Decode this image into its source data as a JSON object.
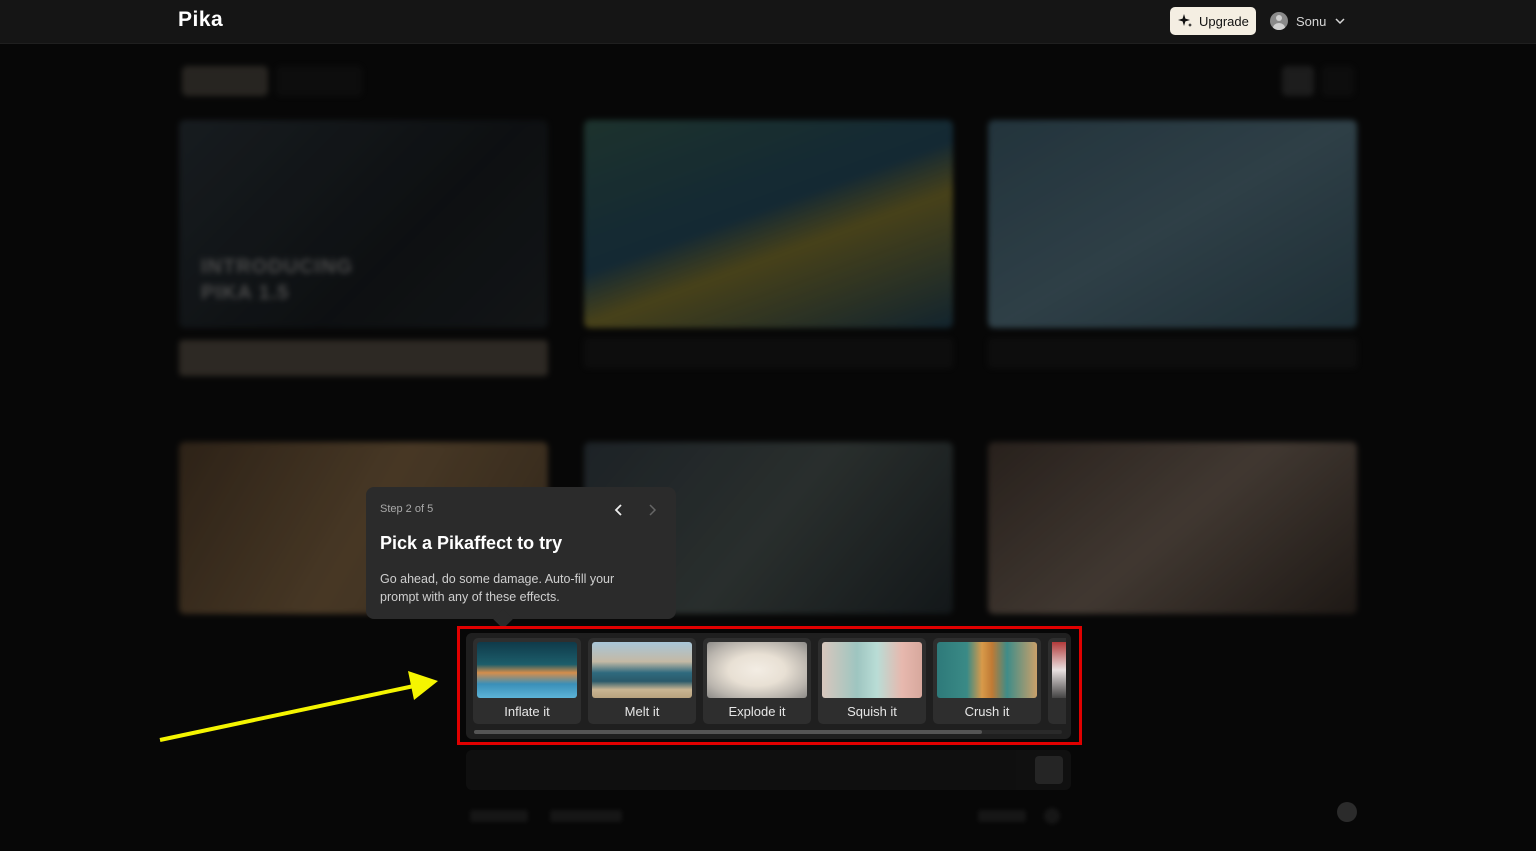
{
  "header": {
    "logo": "Pika",
    "upgrade_label": "Upgrade",
    "user_name": "Sonu"
  },
  "background": {
    "tile_text_line1": "INTRODUCING",
    "tile_text_line2": "PIKA 1.5"
  },
  "tooltip": {
    "step": "Step 2 of 5",
    "title": "Pick a Pikaffect to try",
    "body": "Go ahead, do some damage. Auto-fill your prompt with any of these effects."
  },
  "effects": [
    {
      "label": "Inflate it",
      "icon": "dog-on-pillow-thumbnail"
    },
    {
      "label": "Melt it",
      "icon": "van-in-desert-thumbnail"
    },
    {
      "label": "Explode it",
      "icon": "heart-cake-thumbnail"
    },
    {
      "label": "Squish it",
      "icon": "toy-washing-machine-thumbnail"
    },
    {
      "label": "Crush it",
      "icon": "burger-stack-thumbnail"
    }
  ],
  "colors": {
    "highlight_border": "#e00000",
    "arrow": "#f5f500",
    "upgrade_bg": "#f4eee2"
  }
}
